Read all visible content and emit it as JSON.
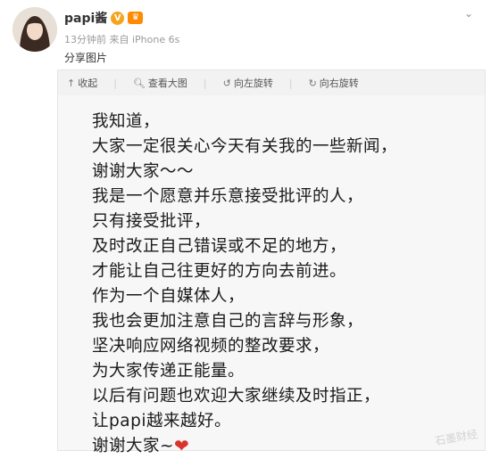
{
  "post": {
    "username": "papi酱",
    "meta": "13分钟前 来自 iPhone 6s",
    "text": "分享图片",
    "avatar_icon": "user-avatar",
    "verified_icon": "verified-badge-icon",
    "member_icon": "vip-member-icon",
    "more_icon": "chevron-down-icon"
  },
  "toolbar": {
    "collapse": "收起",
    "view_large": "查看大图",
    "rotate_left": "向左旋转",
    "rotate_right": "向右旋转"
  },
  "letter": {
    "lines": [
      "我知道，",
      "大家一定很关心今天有关我的一些新闻，",
      "谢谢大家～～",
      "我是一个愿意并乐意接受批评的人，",
      "只有接受批评，",
      "及时改正自己错误或不足的地方，",
      "才能让自己往更好的方向去前进。",
      "作为一个自媒体人，",
      "我也会更加注意自己的言辞与形象，",
      "坚决响应网络视频的整改要求，",
      "为大家传递正能量。",
      "以后有问题也欢迎大家继续及时指正，",
      "让papi越来越好。",
      "谢谢大家~"
    ],
    "heart_icon": "heart-icon"
  },
  "watermark": "石墨财经",
  "colors": {
    "heart": "#d9342b",
    "badge": "#f7a41d",
    "member": "#ff8a00"
  }
}
